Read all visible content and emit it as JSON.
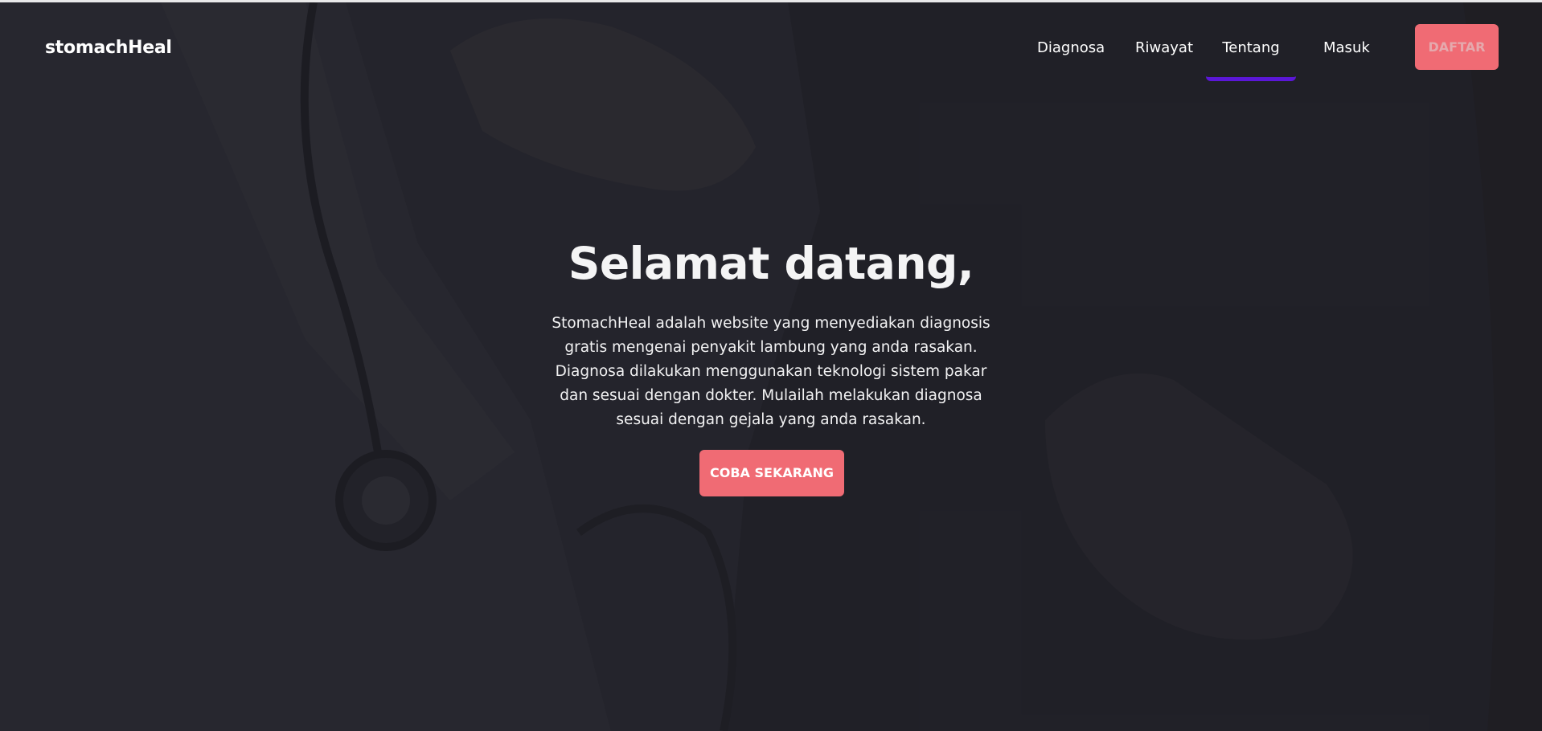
{
  "colors": {
    "background": "#25252c",
    "accent": "#f06b74",
    "active_indicator": "#5b17d8",
    "text": "#ffffff"
  },
  "navbar": {
    "brand": "stomachHeal",
    "links": {
      "diagnosa": "Diagnosa",
      "riwayat": "Riwayat",
      "tentang": "Tentang",
      "masuk": "Masuk"
    },
    "active_link": "Tentang",
    "register_label": "DAFTAR"
  },
  "hero": {
    "title": "Selamat datang,",
    "description": "StomachHeal adalah website yang menyediakan diagnosis gratis mengenai penyakit lambung yang anda rasakan. Diagnosa dilakukan menggunakan teknologi sistem pakar dan sesuai dengan dokter. Mulailah melakukan diagnosa sesuai dengan gejala yang anda rasakan.",
    "cta_label": "COBA SEKARANG"
  },
  "background_image": {
    "icon": "doctor-with-stethoscope-photo"
  }
}
